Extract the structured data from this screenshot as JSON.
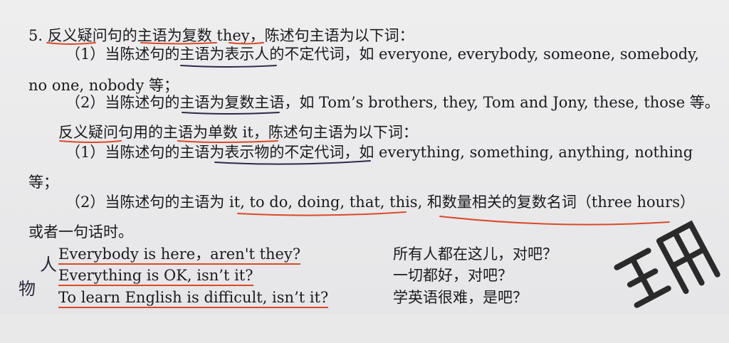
{
  "lines": {
    "l1": "5. 反义疑问句的主语为复数 they，陈述句主语为以下词：",
    "l2": "（1）当陈述句的主语为表示人的不定代词，如 everyone, everybody, someone, somebody,",
    "l3": "no one, nobody 等；",
    "l4": "（2）当陈述句的主语为复数主语，如 Tom’s brothers, they, Tom and Jony, these, those 等。",
    "l5": "反义疑问句用的主语为单数 it，陈述句主语为以下词：",
    "l6": "（1）当陈述句的主语为表示物的不定代词，如 everything, something, anything, nothing",
    "l7": "等；",
    "l8": "（2）当陈述句的主语为 it, to do, doing, that, this, 和数量相关的复数名词（three hours）",
    "l9": "或者一句话时。"
  },
  "examples": [
    {
      "en": "Everybody is here，aren't they?",
      "cn": "所有人都在这儿，对吧？"
    },
    {
      "en": "Everything is OK, isn’t it?",
      "cn": "一切都好，对吧？"
    },
    {
      "en": "To learn English is difficult, isn’t it?",
      "cn": "学英语很难，是吧？"
    }
  ],
  "handwriting": {
    "h1": "人",
    "h2": "物"
  },
  "colors": {
    "underline_red": "#d94a2a",
    "underline_ink": "#2b2b4a",
    "stamp": "#2a2a2a"
  }
}
